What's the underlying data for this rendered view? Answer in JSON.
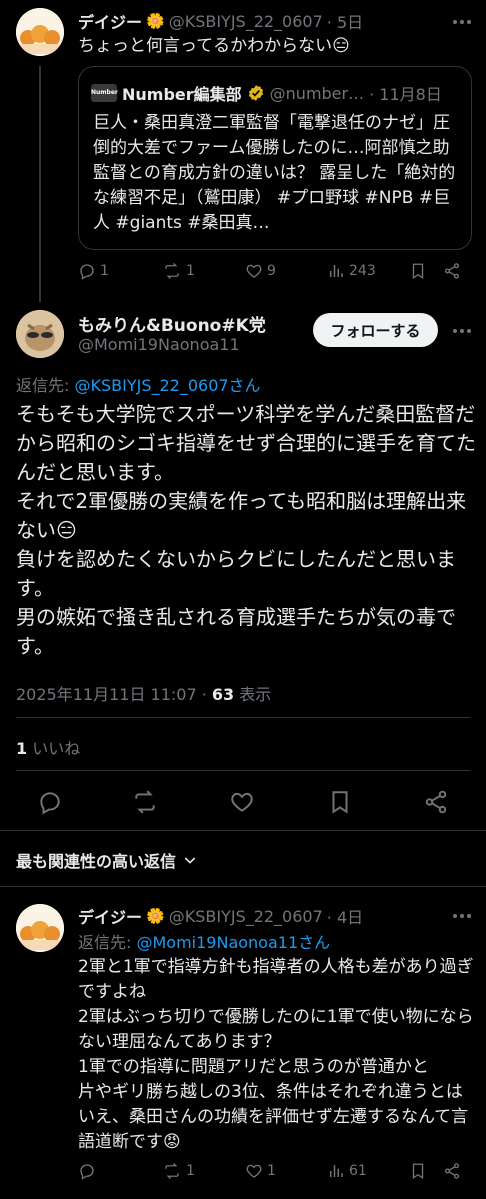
{
  "reply_top": {
    "display_name": "デイジー",
    "handle": "@KSBIYJS_22_0607",
    "dot_time": "· 5日",
    "text": "ちょっと何言ってるかわからない😑",
    "quote": {
      "source_logo": "Number",
      "display_name": "Number編集部",
      "handle": "@number…",
      "dot_time": "· 11月8日",
      "text": "巨人・桑田真澄二軍監督「電撃退任のナゼ」圧倒的大差でファーム優勝したのに…阿部慎之助監督との育成方針の違いは？ 露呈した「絶対的な練習不足」（鷲田康） #プロ野球 #NPB #巨人 #giants #桑田真…"
    },
    "actions": {
      "replies": "1",
      "reposts": "1",
      "likes": "9",
      "views": "243"
    }
  },
  "main_tweet": {
    "display_name": "もみりん&Buono#K党",
    "handle": "@Momi19Naonoa11",
    "follow_label": "フォローする",
    "reply_to_prefix": "返信先: ",
    "reply_to_handle": "@KSBIYJS_22_0607さん",
    "text": "そもそも大学院でスポーツ科学を学んだ桑田監督だから昭和のシゴキ指導をせず合理的に選手を育てたんだと思います。\nそれで2軍優勝の実績を作っても昭和脳は理解出来ない😑\n負けを認めたくないからクビにしたんだと思います。\n男の嫉妬で掻き乱される育成選手たちが気の毒です。",
    "timestamp": "2025年11月11日 11:07",
    "views_count": "63",
    "views_label": "表示",
    "likes_count": "1",
    "likes_label": "いいね"
  },
  "sort": {
    "label": "最も関連性の高い返信"
  },
  "reply_bottom": {
    "display_name": "デイジー",
    "handle": "@KSBIYJS_22_0607",
    "dot_time": "· 4日",
    "reply_to_prefix": "返信先: ",
    "reply_to_handle": "@Momi19Naonoa11さん",
    "text": "2軍と1軍で指導方針も指導者の人格も差があり過ぎですよね\n2軍はぶっち切りで優勝したのに1軍で使い物にならない理屈なんてあります？\n1軍での指導に問題アリだと思うのが普通かと\n片やギリ勝ち越しの3位、条件はそれぞれ違うとはいえ、桑田さんの功績を評価せず左遷するなんて言語道断です😡",
    "actions": {
      "replies": "",
      "reposts": "1",
      "likes": "1",
      "views": "61"
    }
  },
  "colors": {
    "background": "#000000",
    "text": "#e7e9ea",
    "muted": "#71767b",
    "link": "#1d9bf0",
    "verified_gold": "#e2b719"
  }
}
